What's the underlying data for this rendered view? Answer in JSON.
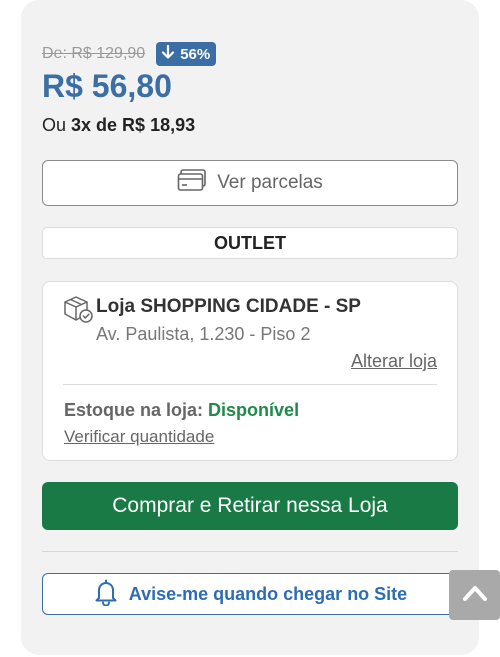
{
  "pricing": {
    "old_price": "De: R$ 129,90",
    "discount": "56%",
    "current_price": "R$ 56,80",
    "installments_prefix": "Ou",
    "installments_value": "3x de R$ 18,93"
  },
  "buttons": {
    "installments_label": "Ver parcelas",
    "buy_pickup_label": "Comprar e Retirar nessa Loja",
    "notify_label": "Avise-me quando chegar no Site"
  },
  "badge": {
    "outlet": "OUTLET"
  },
  "store": {
    "name": "Loja SHOPPING CIDADE - SP",
    "address": "Av. Paulista, 1.230 - Piso 2",
    "change_label": "Alterar loja",
    "stock_label": "Estoque na loja:",
    "stock_status": "Disponível",
    "check_quantity_label": "Verificar quantidade"
  },
  "icons": {
    "discount": "arrow-down-icon",
    "installments": "credit-card-icon",
    "store": "package-check-icon",
    "notify": "bell-icon",
    "scroll_top": "chevron-up-icon"
  },
  "colors": {
    "price_blue": "#3a6ea5",
    "buy_green": "#1a7a46",
    "available_green": "#1f8a4c",
    "notify_blue": "#2e6db4"
  }
}
